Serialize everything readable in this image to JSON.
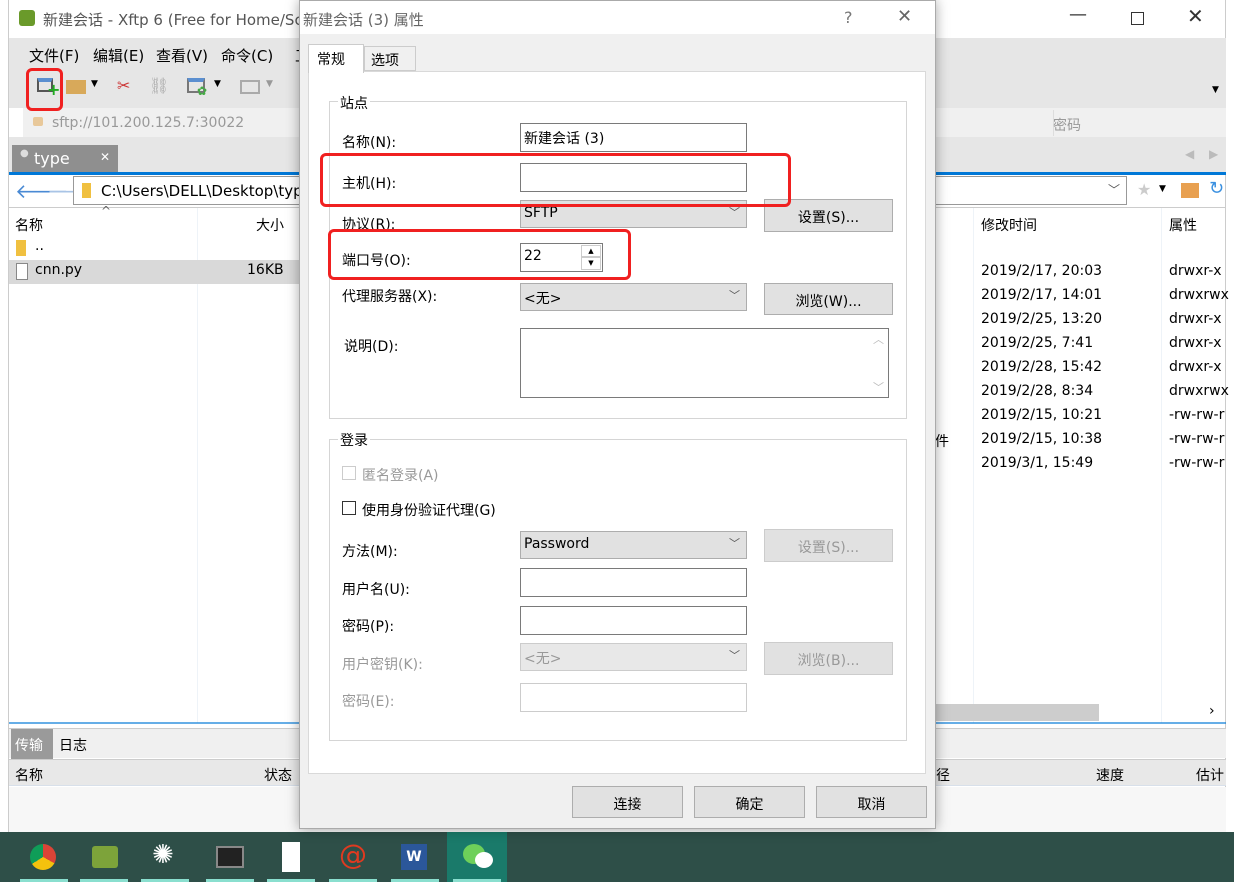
{
  "main_window": {
    "title": "新建会话 - Xftp 6 (Free for Home/Sc",
    "menu": [
      "文件(F)",
      "编辑(E)",
      "查看(V)",
      "命令(C)",
      "工"
    ],
    "address": "sftp://101.200.125.7:30022",
    "password_placeholder": "密码",
    "session_tab": "type",
    "local_path": "C:\\Users\\DELL\\Desktop\\typ",
    "local_columns": [
      "名称",
      "大小"
    ],
    "local_files": [
      {
        "name": "..",
        "size": ""
      },
      {
        "name": "cnn.py",
        "size": "16KB"
      }
    ],
    "remote_columns": [
      "修改时间",
      "属性"
    ],
    "remote_partial": "件",
    "remote_files": [
      {
        "modified": "2019/2/17, 20:03",
        "attr": "drwxr-x"
      },
      {
        "modified": "2019/2/17, 14:01",
        "attr": "drwxrwx"
      },
      {
        "modified": "2019/2/25, 13:20",
        "attr": "drwxr-x"
      },
      {
        "modified": "2019/2/25, 7:41",
        "attr": "drwxr-x"
      },
      {
        "modified": "2019/2/28, 15:42",
        "attr": "drwxr-x"
      },
      {
        "modified": "2019/2/28, 8:34",
        "attr": "drwxrwx"
      },
      {
        "modified": "2019/2/15, 10:21",
        "attr": "-rw-rw-r"
      },
      {
        "modified": "2019/2/15, 10:38",
        "attr": "-rw-rw-r"
      },
      {
        "modified": "2019/3/1, 15:49",
        "attr": "-rw-rw-r"
      }
    ],
    "bottom_tabs": [
      "传输",
      "日志"
    ],
    "transfer_columns": [
      "名称",
      "状态",
      "径",
      "速度",
      "估计"
    ]
  },
  "dialog": {
    "title": "新建会话 (3) 属性",
    "help": "?",
    "tabs": [
      "常规",
      "选项"
    ],
    "site_group": "站点",
    "name_label": "名称(N):",
    "name_value": "新建会话 (3)",
    "host_label": "主机(H):",
    "host_value": "",
    "protocol_label": "协议(R):",
    "protocol_value": "SFTP",
    "settings_button": "设置(S)...",
    "port_label": "端口号(O):",
    "port_value": "22",
    "proxy_label": "代理服务器(X):",
    "proxy_value": "<无>",
    "browse_w_button": "浏览(W)...",
    "desc_label": "说明(D):",
    "desc_value": "",
    "login_group": "登录",
    "anonymous_label": "匿名登录(A)",
    "agent_label": "使用身份验证代理(G)",
    "method_label": "方法(M):",
    "method_value": "Password",
    "method_settings_button": "设置(S)...",
    "username_label": "用户名(U):",
    "username_value": "",
    "password_label": "密码(P):",
    "password_value": "",
    "userkey_label": "用户密钥(K):",
    "userkey_value": "<无>",
    "browse_b_button": "浏览(B)...",
    "passphrase_label": "密码(E):",
    "passphrase_value": "",
    "connect_button": "连接",
    "ok_button": "确定",
    "cancel_button": "取消"
  },
  "taskbar": [
    "chrome",
    "xftp",
    "network-tool",
    "terminal",
    "calculator",
    "snail-app",
    "word",
    "wechat"
  ],
  "colors": {
    "highlight": "#f02020",
    "taskbar": "#2e4f48",
    "accent": "#0078d7"
  }
}
